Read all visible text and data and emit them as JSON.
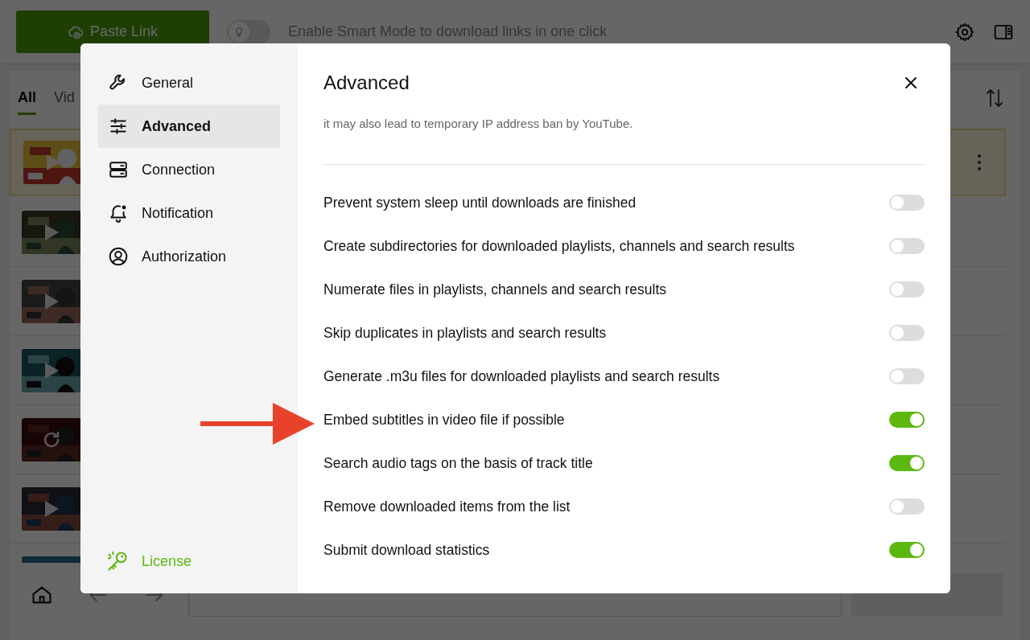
{
  "toolbar": {
    "paste_button": "Paste Link",
    "smart_mode": {
      "on": false,
      "label": "Enable Smart Mode to download links in one click"
    }
  },
  "tabs": [
    {
      "label": "All",
      "selected": true
    },
    {
      "label": "Vid",
      "selected": false
    }
  ],
  "downloads": [
    {
      "kind": "playable",
      "selected": true
    },
    {
      "kind": "playable",
      "selected": false
    },
    {
      "kind": "playable",
      "selected": false
    },
    {
      "kind": "playable",
      "selected": false
    },
    {
      "kind": "processing",
      "selected": false
    },
    {
      "kind": "playable",
      "selected": false
    },
    {
      "kind": "thumbnail",
      "selected": false
    }
  ],
  "annotations": [
    {
      "kind": "arrow",
      "color": "#e8432a"
    }
  ],
  "settings": {
    "nav": [
      {
        "kind": "wrench",
        "label": "General",
        "selected": false
      },
      {
        "kind": "sliders",
        "label": "Advanced",
        "selected": true
      },
      {
        "kind": "server",
        "label": "Connection",
        "selected": false
      },
      {
        "kind": "bell",
        "label": "Notification",
        "selected": false
      },
      {
        "kind": "user",
        "label": "Authorization",
        "selected": false
      }
    ],
    "license": "License",
    "title": "Advanced",
    "note": "it may also lead to temporary IP address ban by YouTube.",
    "options": [
      {
        "label": "Prevent system sleep until downloads are finished",
        "on": false
      },
      {
        "label": "Create subdirectories for downloaded playlists, channels and search results",
        "on": false
      },
      {
        "label": "Numerate files in playlists, channels and search results",
        "on": false
      },
      {
        "label": "Skip duplicates in playlists and search results",
        "on": false
      },
      {
        "label": "Generate .m3u files for downloaded playlists and search results",
        "on": false
      },
      {
        "label": "Embed subtitles in video file if possible",
        "on": true
      },
      {
        "label": "Search audio tags on the basis of track title",
        "on": true
      },
      {
        "label": "Remove downloaded items from the list",
        "on": false
      },
      {
        "label": "Submit download statistics",
        "on": true
      }
    ]
  }
}
